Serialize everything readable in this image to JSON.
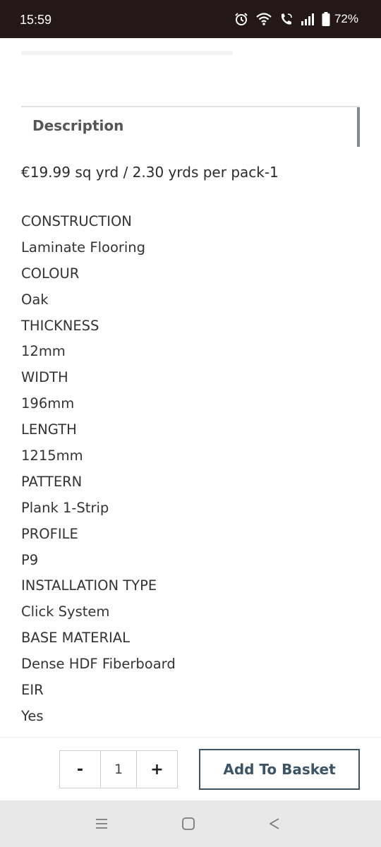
{
  "status_bar": {
    "time": "15:59",
    "battery": "72%",
    "icons": [
      "alarm-icon",
      "wifi-icon",
      "wifi-call-icon",
      "signal-icon",
      "battery-icon"
    ]
  },
  "description": {
    "tab_label": "Description",
    "price_line": "€19.99 sq yrd / 2.30 yrds per pack-1",
    "specs": [
      "CONSTRUCTION",
      "Laminate Flooring",
      "COLOUR",
      "Oak",
      "THICKNESS",
      "12mm",
      "WIDTH",
      "196mm",
      "LENGTH",
      "1215mm",
      "PATTERN",
      "Plank 1-Strip",
      "PROFILE",
      "P9",
      "INSTALLATION TYPE",
      "Click System",
      "BASE MATERIAL",
      "Dense HDF Fiberboard",
      "EIR",
      "Yes"
    ]
  },
  "purchase": {
    "decrement_label": "-",
    "quantity": "1",
    "increment_label": "+",
    "add_to_basket_label": "Add To Basket"
  },
  "nav_bar": {
    "icons": [
      "recent-apps-icon",
      "home-icon",
      "back-icon"
    ]
  },
  "colors": {
    "status_bar_bg": "#231717",
    "accent": "#3d5366",
    "nav_bar_bg": "#e8e8e8"
  }
}
